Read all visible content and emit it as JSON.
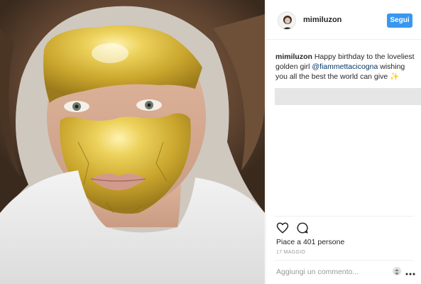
{
  "post": {
    "username": "mimiluzon",
    "follow_label": "Segui",
    "caption_user": "mimiluzon",
    "caption_text_1": " Happy birthday to the loveliest golden girl ",
    "caption_mention": "@fiammettacicogna",
    "caption_text_2": " wishing you all the best the world can give ✨",
    "likes": "Piace a 401 persone",
    "date": "17 MAGGIO",
    "comment_placeholder": "Aggiungi un commento..."
  },
  "icons": {
    "like": "heart-icon",
    "comment": "comment-icon",
    "more": "more-options-icon"
  },
  "colors": {
    "follow_button": "#3897f0",
    "mention": "#003569",
    "gold_mask": "#d8b83a"
  }
}
